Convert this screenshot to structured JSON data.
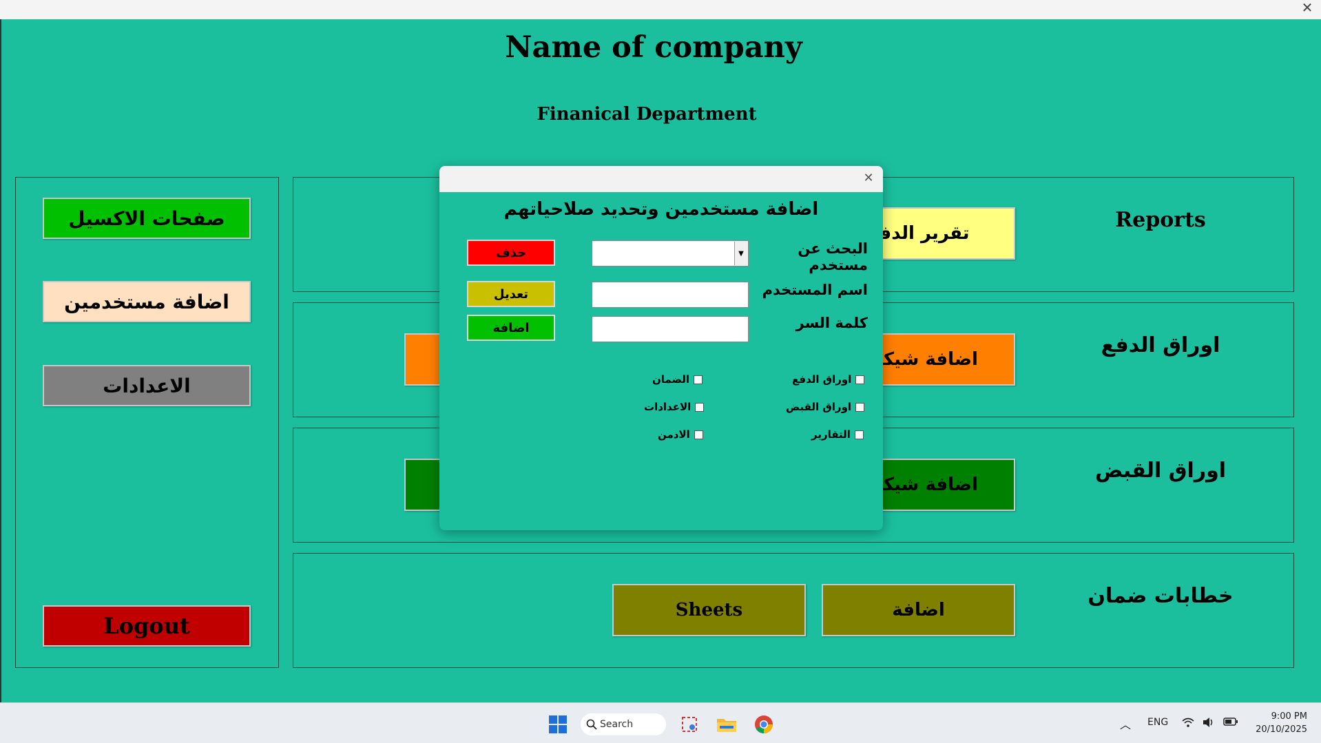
{
  "window": {
    "close_glyph": "✕"
  },
  "header": {
    "company": "Name of company",
    "department": "Finanical Department"
  },
  "sidebar": {
    "excel_pages": "صفحات الاكسيل",
    "add_users": "اضافة مستخدمين",
    "settings": "الاعدادات",
    "logout": "Logout"
  },
  "sections": {
    "reports": {
      "label": "Reports",
      "button": "تقرير الدفع"
    },
    "payables": {
      "label": "اوراق الدفع",
      "button": "اضافة شيكات"
    },
    "receivables": {
      "label": "اوراق القبض",
      "button": "اضافة شيكات"
    },
    "guarantees": {
      "label": "خطابات ضمان",
      "add_button": "اضافة",
      "sheets_button": "Sheets"
    }
  },
  "dialog": {
    "close_glyph": "✕",
    "title": "اضافة مستخدمين وتحديد صلاحياتهم",
    "search_label": "البحث عن مستخدم",
    "search_value": "",
    "username_label": "اسم المستخدم",
    "username_value": "",
    "password_label": "كلمة السر",
    "password_value": "",
    "delete_button": "حذف",
    "edit_button": "تعديل",
    "add_button": "اضافة",
    "perms": {
      "payables": "اوراق الدفع",
      "receivables": "اوراق القبض",
      "reports": "التقارير",
      "guarantee": "الضمان",
      "settings": "الاعدادات",
      "admin": "الادمن"
    }
  },
  "taskbar": {
    "search": "Search",
    "language": "ENG",
    "time": "9:00 PM",
    "date": "20/10/2025"
  },
  "colors": {
    "background": "#1bbf9e",
    "green": "#00c000",
    "peach": "#ffe0c0",
    "gray": "#808080",
    "red": "#c00000",
    "yellow": "#ffff80",
    "orange": "#ff8000",
    "darkgreen": "#008000",
    "olive": "#808000"
  }
}
